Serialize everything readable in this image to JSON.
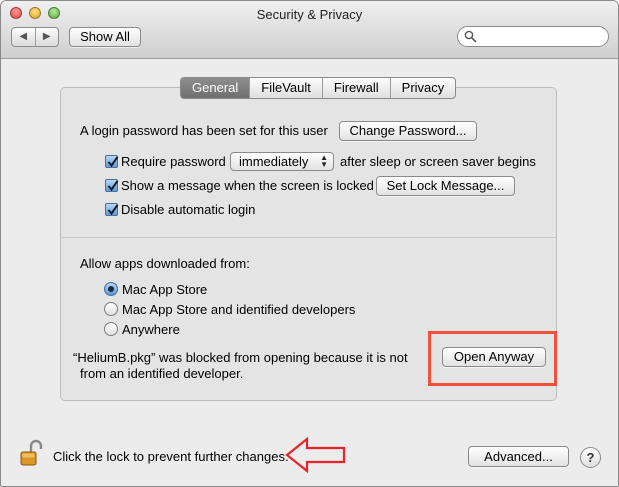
{
  "window": {
    "title": "Security & Privacy"
  },
  "toolbar": {
    "back_glyph": "◀",
    "forward_glyph": "▶",
    "show_all_label": "Show All",
    "search_placeholder": ""
  },
  "tabs": [
    {
      "label": "General",
      "active": true
    },
    {
      "label": "FileVault",
      "active": false
    },
    {
      "label": "Firewall",
      "active": false
    },
    {
      "label": "Privacy",
      "active": false
    }
  ],
  "general": {
    "password_text": "A login password has been set for this user",
    "change_password_label": "Change Password...",
    "require_password": {
      "label": "Require password",
      "checked": true,
      "value": "immediately",
      "suffix": "after sleep or screen saver begins"
    },
    "show_message": {
      "label": "Show a message when the screen is locked",
      "checked": true,
      "button_label": "Set Lock Message..."
    },
    "disable_auto_login": {
      "label": "Disable automatic login",
      "checked": true
    }
  },
  "gatekeeper": {
    "heading": "Allow apps downloaded from:",
    "options": [
      {
        "label": "Mac App Store",
        "selected": true
      },
      {
        "label": "Mac App Store and identified developers",
        "selected": false
      },
      {
        "label": "Anywhere",
        "selected": false
      }
    ],
    "blocked_line1": "“HeliumB.pkg” was blocked from opening because it is not",
    "blocked_line2": "from an identified developer.",
    "open_anyway_label": "Open Anyway"
  },
  "footer": {
    "lock_text": "Click the lock to prevent further changes.",
    "advanced_label": "Advanced...",
    "help_label": "?"
  },
  "colors": {
    "highlight_box": "#f0503c",
    "arrow": "#e8232a",
    "active_tab": "#7a7a7a",
    "checkbox_fill": "#5c98d6"
  }
}
